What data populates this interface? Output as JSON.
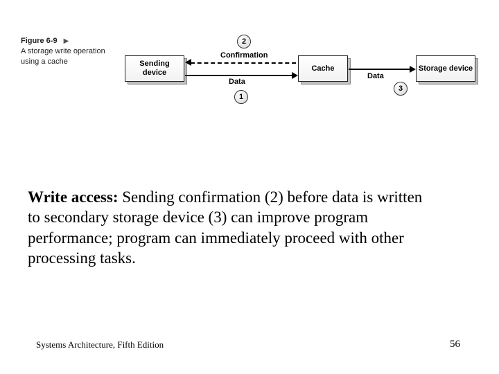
{
  "figure": {
    "number": "Figure 6-9",
    "caption": "A storage write operation using a cache"
  },
  "diagram": {
    "boxes": {
      "sending": "Sending device",
      "cache": "Cache",
      "storage": "Storage device"
    },
    "labels": {
      "confirmation": "Confirmation",
      "data1": "Data",
      "data2": "Data"
    },
    "steps": {
      "s1": "1",
      "s2": "2",
      "s3": "3"
    }
  },
  "body": {
    "lead": "Write access:",
    "text": " Sending confirmation (2) before data is written to secondary storage device (3) can improve program performance; program can immediately proceed with other processing tasks."
  },
  "footer": {
    "book": "Systems Architecture, Fifth Edition",
    "page": "56"
  }
}
